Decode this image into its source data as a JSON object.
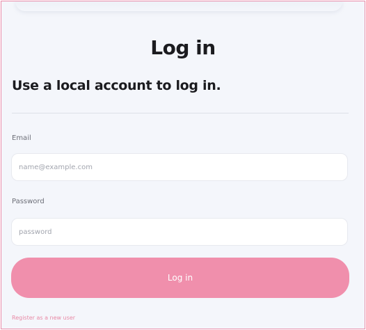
{
  "page": {
    "title": "Log in",
    "subtitle": "Use a local account to log in."
  },
  "form": {
    "email_label": "Email",
    "email_placeholder": "name@example.com",
    "password_label": "Password",
    "password_placeholder": "password",
    "submit_label": "Log in"
  },
  "links": {
    "register": "Register as a new user"
  },
  "side_notes": {
    "line1": "",
    "line2": ""
  },
  "colors": {
    "accent": "#f08fac",
    "border": "#e98aa8",
    "background": "#f4f6fb"
  }
}
